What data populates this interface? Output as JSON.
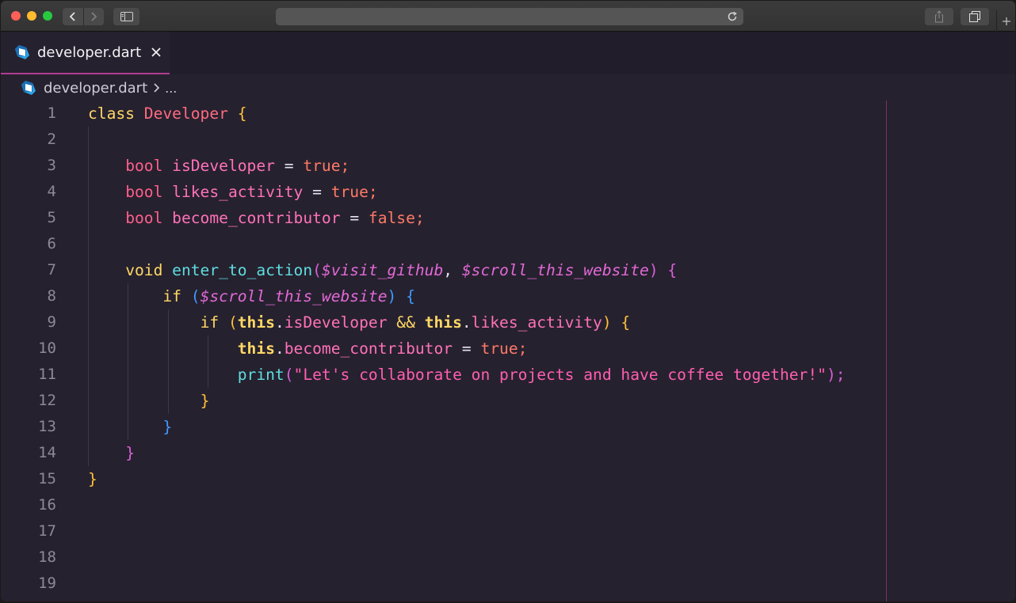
{
  "tab": {
    "label": "developer.dart"
  },
  "breadcrumb": {
    "file": "developer.dart",
    "more": "..."
  },
  "colors": {
    "accent": "#b03c90",
    "background": "#26212f",
    "ruler": "#7a2f6c"
  },
  "icons": {
    "back": "chevron-left-icon",
    "forward": "chevron-right-icon",
    "sidebar": "sidebar-icon",
    "reload": "reload-icon",
    "share": "share-icon",
    "tabs": "tabs-overview-icon",
    "new_tab": "plus-icon",
    "file": "dart-icon",
    "close": "close-icon"
  },
  "line_numbers": [
    "1",
    "2",
    "3",
    "4",
    "5",
    "6",
    "7",
    "8",
    "9",
    "10",
    "11",
    "12",
    "13",
    "14",
    "15",
    "16",
    "17",
    "18",
    "19"
  ],
  "code": {
    "l1": {
      "kw": "class",
      "name": "Developer",
      "brace": "{"
    },
    "l3": {
      "type": "bool",
      "ident": "isDeveloper",
      "op": "=",
      "val": "true",
      "semi": ";"
    },
    "l4": {
      "type": "bool",
      "ident": "likes_activity",
      "op": "=",
      "val": "true",
      "semi": ";"
    },
    "l5": {
      "type": "bool",
      "ident": "become_contributor",
      "op": "=",
      "val": "false",
      "semi": ";"
    },
    "l7": {
      "type": "void",
      "fn": "enter_to_action",
      "open": "(",
      "p1": "$visit_github",
      "comma": ",",
      "p2": "$scroll_this_website",
      "close": ")",
      "brace": "{"
    },
    "l8": {
      "kw": "if",
      "open": "(",
      "p": "$scroll_this_website",
      "close": ")",
      "brace": "{"
    },
    "l9": {
      "kw": "if",
      "open": "(",
      "this1": "this",
      "dot1": ".",
      "a": "isDeveloper",
      "and": "&&",
      "this2": "this",
      "dot2": ".",
      "b": "likes_activity",
      "close": ")",
      "brace": "{"
    },
    "l10": {
      "this": "this",
      "dot": ".",
      "ident": "become_contributor",
      "op": "=",
      "val": "true",
      "semi": ";"
    },
    "l11": {
      "fn": "print",
      "open": "(",
      "str": "\"Let's collaborate on projects and have coffee together!\"",
      "close": ")",
      "semi": ";"
    },
    "l12": {
      "brace": "}"
    },
    "l13": {
      "brace": "}"
    },
    "l14": {
      "brace": "}"
    },
    "l15": {
      "brace": "}"
    }
  }
}
